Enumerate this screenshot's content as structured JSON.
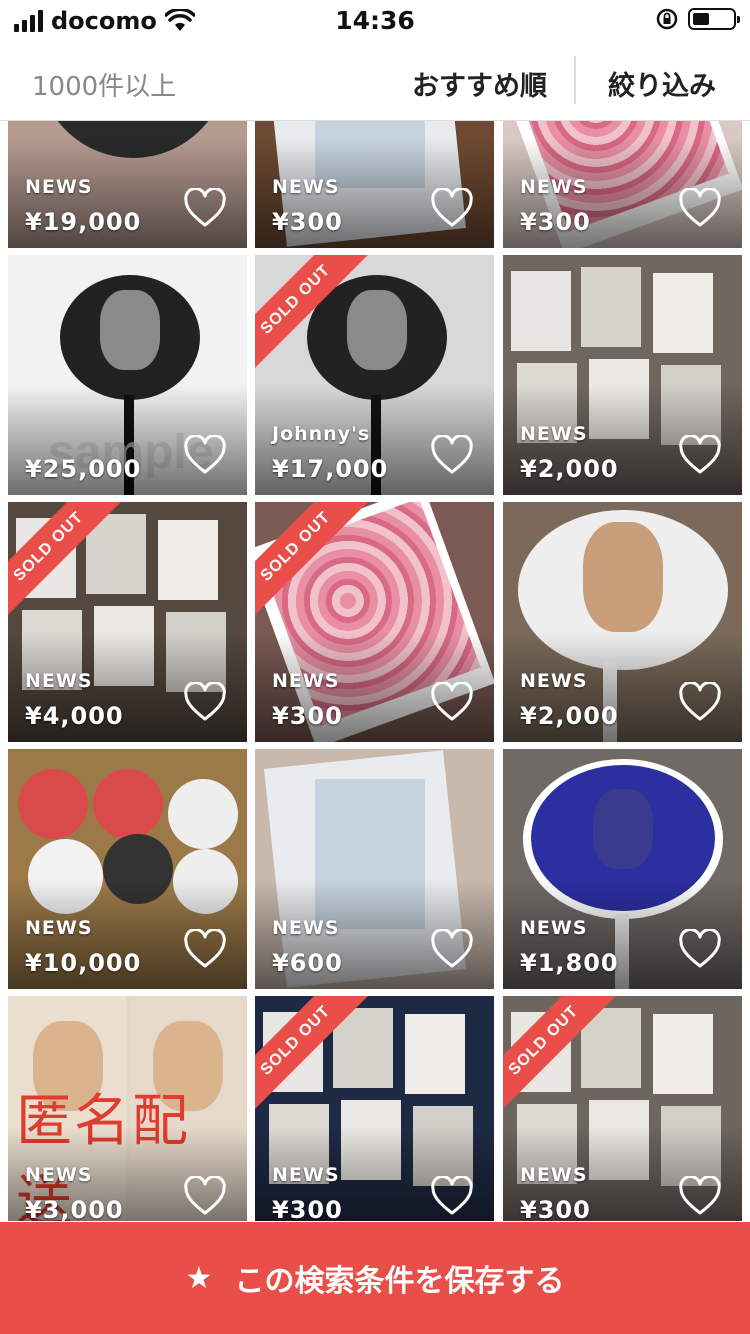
{
  "status_bar": {
    "carrier": "docomo",
    "time": "14:36"
  },
  "header": {
    "result_count": "1000件以上",
    "sort_label": "おすすめ順",
    "filter_label": "絞り込み"
  },
  "items": [
    {
      "brand": "NEWS",
      "price": "¥19,000",
      "sold_out": false,
      "bg": "#b59a90",
      "variant": "fan"
    },
    {
      "brand": "NEWS",
      "price": "¥300",
      "sold_out": false,
      "bg": "#6e4a32",
      "variant": "poster"
    },
    {
      "brand": "NEWS",
      "price": "¥300",
      "sold_out": false,
      "bg": "#d9c8c4",
      "variant": "flowers"
    },
    {
      "brand": "",
      "price": "¥25,000",
      "sold_out": false,
      "bg": "#f2f2f2",
      "variant": "fan-dark",
      "watermark": "sample"
    },
    {
      "brand": "Johnny's",
      "price": "¥17,000",
      "sold_out": true,
      "sold_out_label": "SOLD OUT",
      "bg": "#d8d8d8",
      "variant": "fan-dark"
    },
    {
      "brand": "NEWS",
      "price": "¥2,000",
      "sold_out": false,
      "bg": "#6f6660",
      "variant": "photos"
    },
    {
      "brand": "NEWS",
      "price": "¥4,000",
      "sold_out": true,
      "sold_out_label": "SOLD OUT",
      "bg": "#54483f",
      "variant": "photos"
    },
    {
      "brand": "NEWS",
      "price": "¥300",
      "sold_out": true,
      "sold_out_label": "SOLD OUT",
      "bg": "#7a5a52",
      "variant": "flowers"
    },
    {
      "brand": "NEWS",
      "price": "¥2,000",
      "sold_out": false,
      "bg": "#7b6a5a",
      "variant": "fan-light"
    },
    {
      "brand": "NEWS",
      "price": "¥10,000",
      "sold_out": false,
      "bg": "#9c7a48",
      "variant": "fans"
    },
    {
      "brand": "NEWS",
      "price": "¥600",
      "sold_out": false,
      "bg": "#c9b9ad",
      "variant": "poster"
    },
    {
      "brand": "NEWS",
      "price": "¥1,800",
      "sold_out": false,
      "bg": "#6f6a66",
      "variant": "fan-blue"
    },
    {
      "brand": "NEWS",
      "price": "¥3,000",
      "sold_out": false,
      "bg": "#e4d7c8",
      "variant": "faces",
      "overlay": "匿名配送"
    },
    {
      "brand": "NEWS",
      "price": "¥300",
      "sold_out": true,
      "sold_out_label": "SOLD OUT",
      "bg": "#1e2a44",
      "variant": "photos"
    },
    {
      "brand": "NEWS",
      "price": "¥300",
      "sold_out": true,
      "sold_out_label": "SOLD OUT",
      "bg": "#6c6560",
      "variant": "photos"
    }
  ],
  "save_bar": {
    "label": "この検索条件を保存する"
  },
  "colors": {
    "accent": "#e94f48"
  }
}
